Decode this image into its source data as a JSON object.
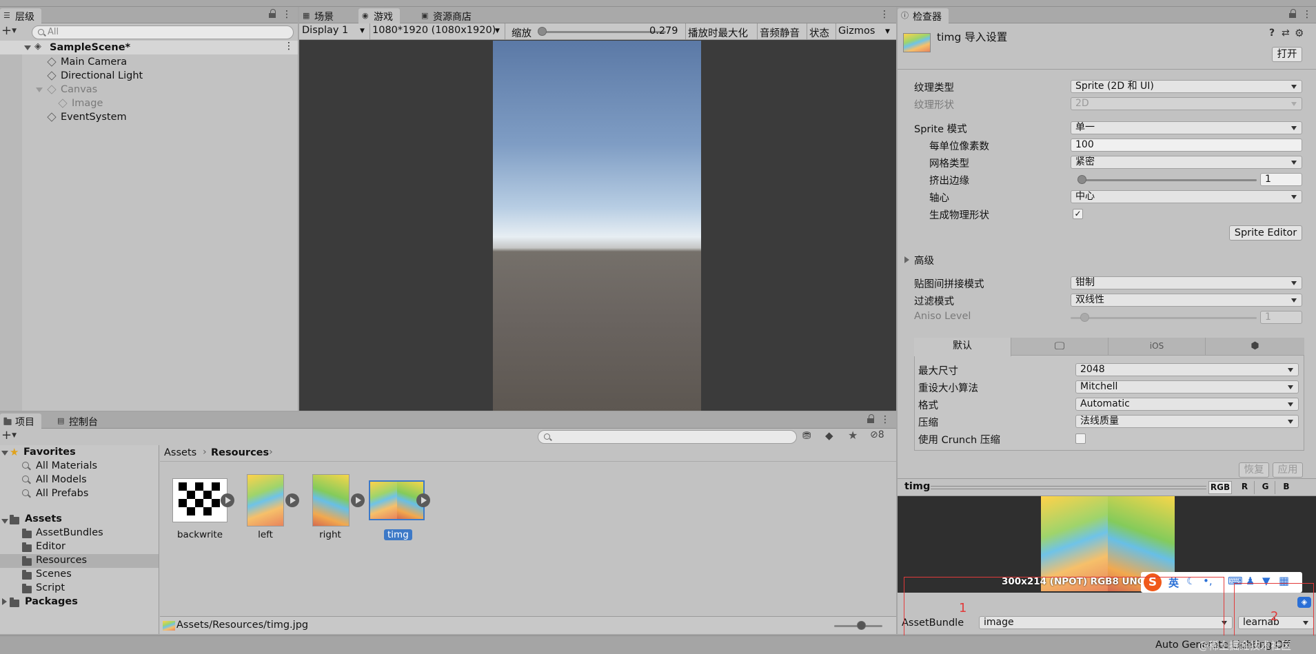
{
  "hierarchy": {
    "tab": "层级",
    "search_placeholder": "All",
    "scene": "SampleScene*",
    "items": [
      {
        "label": "Main Camera",
        "dim": false
      },
      {
        "label": "Directional Light",
        "dim": false
      },
      {
        "label": "Canvas",
        "dim": true
      },
      {
        "label": "Image",
        "dim": true
      },
      {
        "label": "EventSystem",
        "dim": false
      }
    ]
  },
  "game": {
    "tabs": [
      "场景",
      "游戏",
      "资源商店"
    ],
    "display": "Display 1",
    "resolution": "1080*1920 (1080x1920)",
    "scale_label": "缩放",
    "scale_value": "0.279x",
    "maximize": "播放时最大化",
    "mute": "音频静音",
    "stats": "状态",
    "gizmos": "Gizmos"
  },
  "project": {
    "tabs": [
      "项目",
      "控制台"
    ],
    "badge_count": "8",
    "favorites": {
      "label": "Favorites",
      "items": [
        "All Materials",
        "All Models",
        "All Prefabs"
      ]
    },
    "assets": {
      "label": "Assets",
      "items": [
        "AssetBundles",
        "Editor",
        "Resources",
        "Scenes",
        "Script"
      ]
    },
    "packages": "Packages",
    "breadcrumb": {
      "root": "Assets",
      "current": "Resources"
    },
    "thumbs": [
      {
        "label": "backwrite"
      },
      {
        "label": "left"
      },
      {
        "label": "right"
      },
      {
        "label": "timg"
      }
    ],
    "status_path": "Assets/Resources/timg.jpg"
  },
  "inspector": {
    "tab": "检查器",
    "title": "timg 导入设置",
    "open_button": "打开",
    "texture_type": {
      "label": "纹理类型",
      "value": "Sprite (2D 和 UI)"
    },
    "texture_shape": {
      "label": "纹理形状",
      "value": "2D"
    },
    "sprite_mode": {
      "label": "Sprite 模式",
      "value": "单一"
    },
    "pixels_per_unit": {
      "label": "每单位像素数",
      "value": "100"
    },
    "mesh_type": {
      "label": "网格类型",
      "value": "紧密"
    },
    "extrude_edges": {
      "label": "挤出边缘",
      "value": "1"
    },
    "pivot": {
      "label": "轴心",
      "value": "中心"
    },
    "gen_physics": {
      "label": "生成物理形状",
      "checked": "✓"
    },
    "sprite_editor": "Sprite Editor",
    "advanced": "高级",
    "wrap_mode": {
      "label": "贴图间拼接模式",
      "value": "钳制"
    },
    "filter_mode": {
      "label": "过滤模式",
      "value": "双线性"
    },
    "aniso": {
      "label": "Aniso Level",
      "value": "1"
    },
    "platform_tabs": {
      "default": "默认",
      "ios": "iOS"
    },
    "max_size": {
      "label": "最大尺寸",
      "value": "2048"
    },
    "resize": {
      "label": "重设大小算法",
      "value": "Mitchell"
    },
    "format": {
      "label": "格式",
      "value": "Automatic"
    },
    "compression": {
      "label": "压缩",
      "value": "法线质量"
    },
    "crunch": {
      "label": "使用 Crunch 压缩"
    },
    "revert": "恢复",
    "apply": "应用",
    "preview": {
      "name": "timg",
      "channels": [
        "RGB",
        "R",
        "G",
        "B"
      ],
      "info": "300x214 (NPOT)  RGB8 UNC"
    },
    "assetbundle": {
      "label": "AssetBundle",
      "name": "image",
      "variant": "learnab",
      "annotation_1": "1",
      "annotation_2": "2"
    },
    "ime": {
      "lang": "英"
    },
    "status": "Auto Generate Lighting Off",
    "watermark": "@稀土掘金技术社区"
  },
  "colors": {
    "panel": "#c2c2c2",
    "selection": "#3d79c7",
    "annotation_red": "#e23a3a"
  }
}
